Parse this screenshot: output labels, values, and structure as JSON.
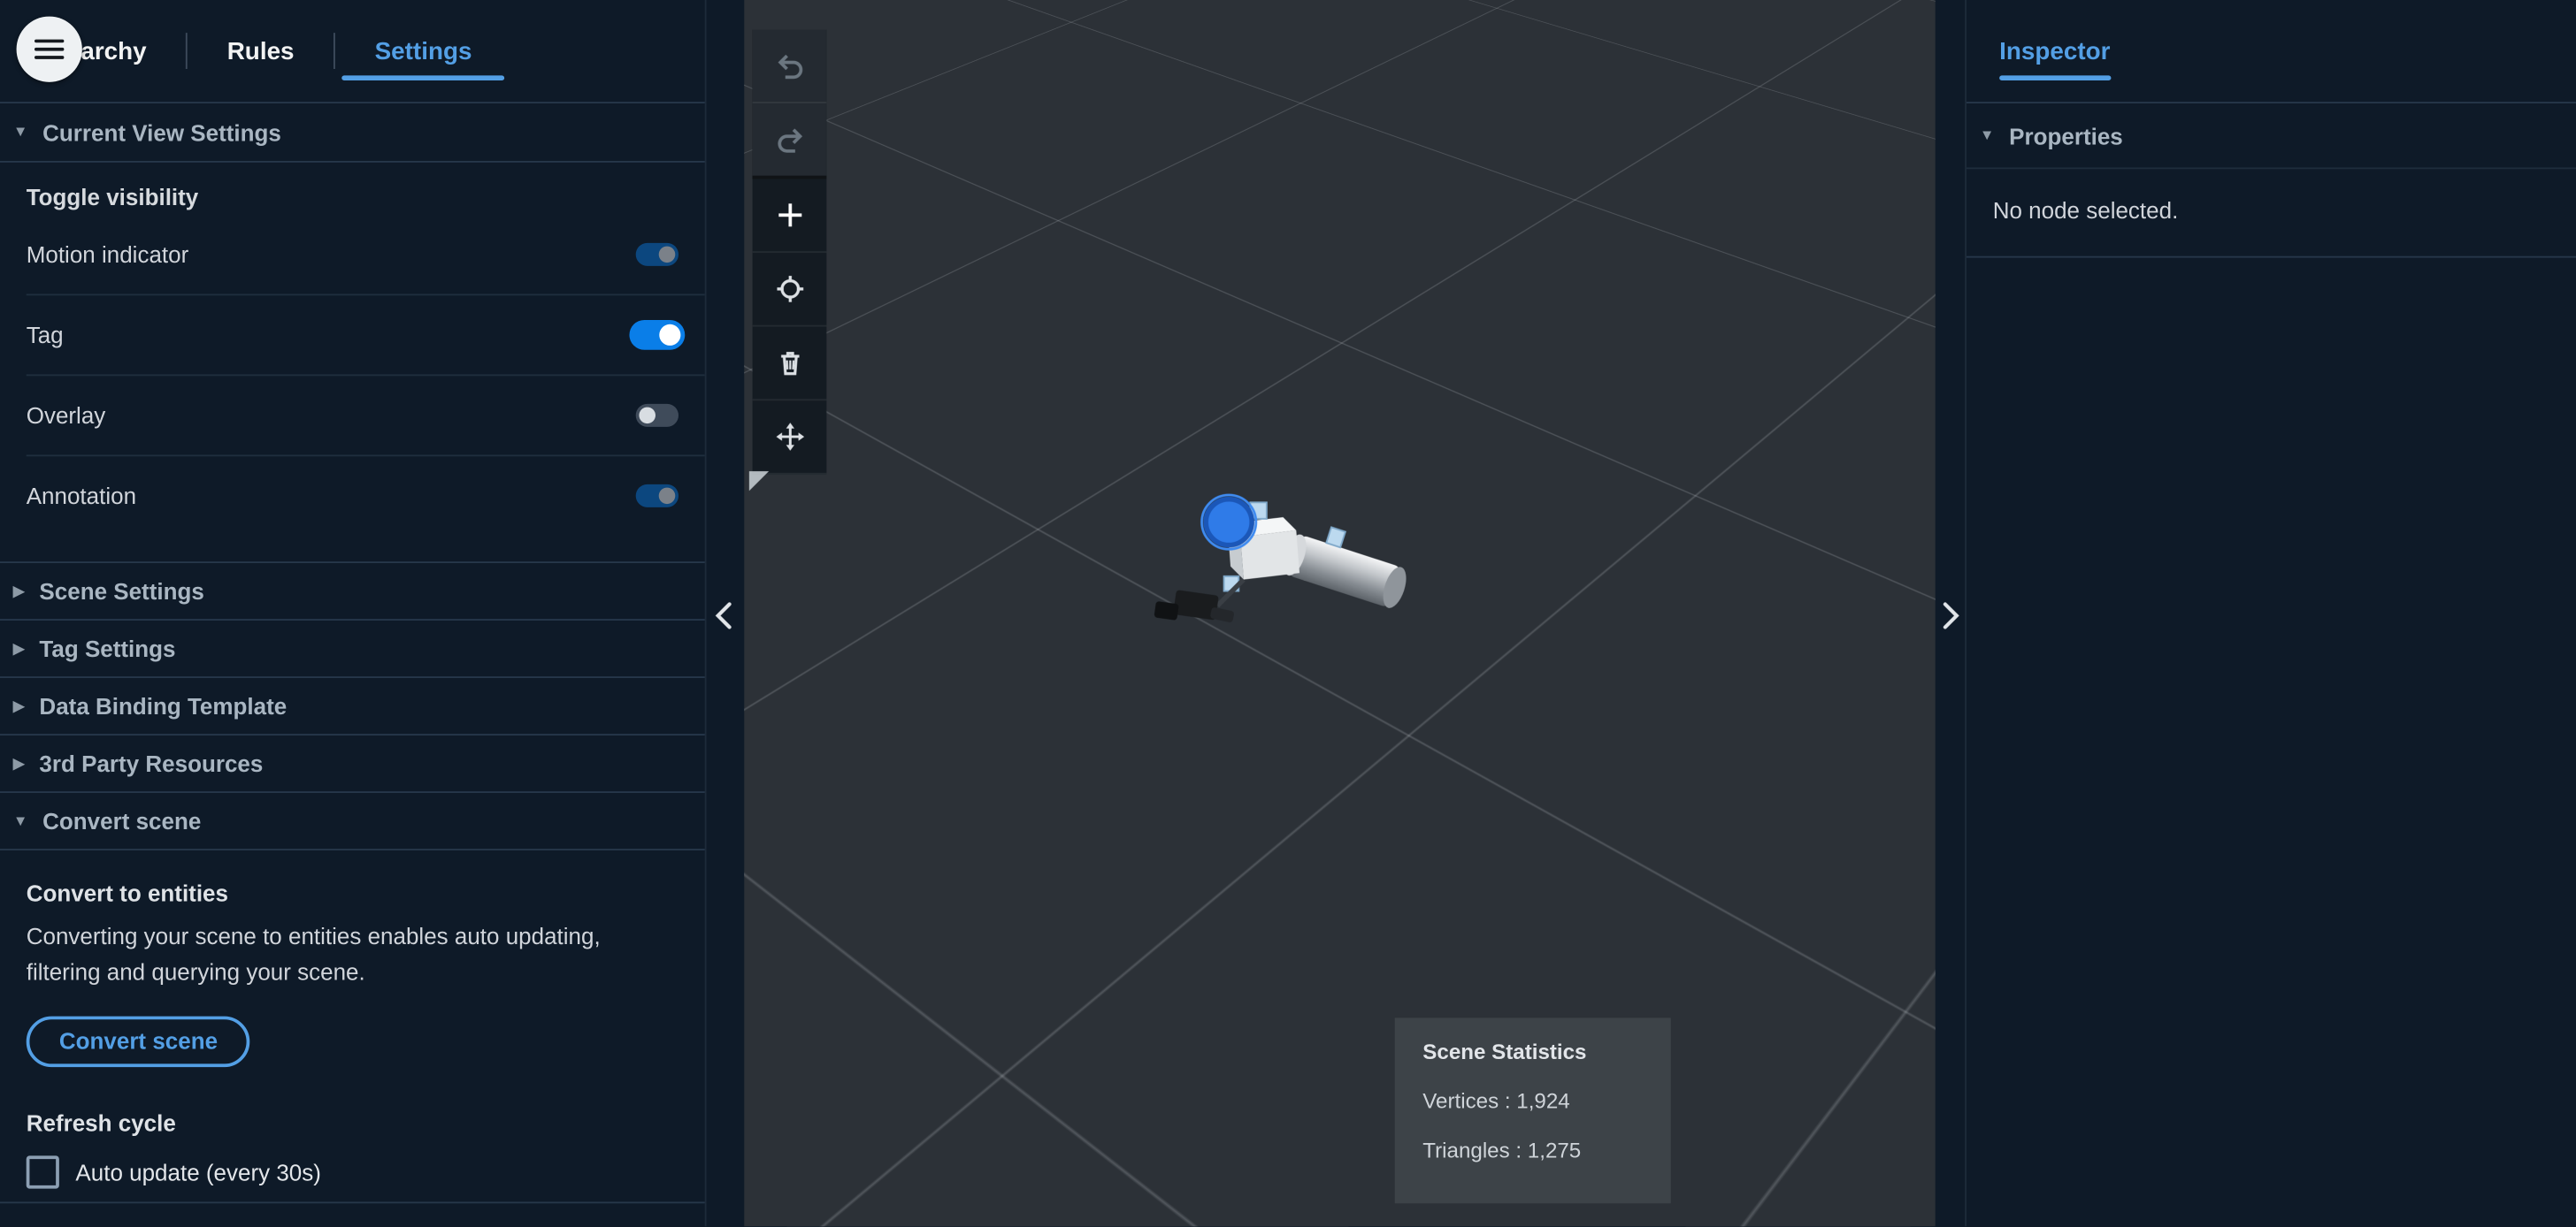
{
  "colors": {
    "accent": "#539fe5",
    "toggle_on": "#0a7ee8",
    "panel_bg": "#0e1a28",
    "viewport_bg": "#2c3137"
  },
  "icons": {
    "caret_down": "▼",
    "caret_right": "▶"
  },
  "header": {
    "menu_icon": "hamburger-menu",
    "tabs": [
      {
        "label": "Hierarchy",
        "active": false
      },
      {
        "label": "Rules",
        "active": false
      },
      {
        "label": "Settings",
        "active": true
      }
    ]
  },
  "left_panel": {
    "current_view": {
      "title": "Current View Settings",
      "subsection": "Toggle visibility",
      "toggles": [
        {
          "label": "Motion indicator",
          "state": "on",
          "dimmed": true
        },
        {
          "label": "Tag",
          "state": "on",
          "dimmed": false
        },
        {
          "label": "Overlay",
          "state": "off",
          "dimmed": false
        },
        {
          "label": "Annotation",
          "state": "on",
          "dimmed": true
        }
      ]
    },
    "collapsed_sections": [
      {
        "title": "Scene Settings"
      },
      {
        "title": "Tag Settings"
      },
      {
        "title": "Data Binding Template"
      },
      {
        "title": "3rd Party Resources"
      }
    ],
    "convert_scene": {
      "title": "Convert scene",
      "heading": "Convert to entities",
      "description": "Converting your scene to entities enables auto updating, filtering and querying your scene.",
      "button": "Convert scene",
      "refresh_heading": "Refresh cycle",
      "checkbox_label": "Auto update (every 30s)",
      "checkbox_checked": false
    }
  },
  "viewport": {
    "toolbar_buttons": [
      "undo",
      "redo",
      "add",
      "anchor",
      "delete",
      "navigate"
    ],
    "scene_statistics": {
      "title": "Scene Statistics",
      "vertices": "Vertices : 1,924",
      "triangles": "Triangles : 1,275"
    }
  },
  "right_panel": {
    "tab": "Inspector",
    "properties": {
      "title": "Properties",
      "empty_message": "No node selected."
    }
  }
}
